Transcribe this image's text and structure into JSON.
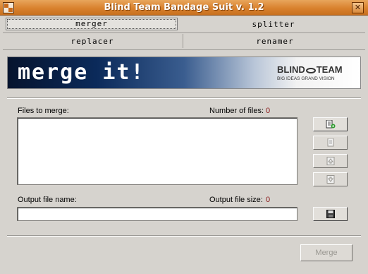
{
  "window": {
    "title": "Blind Team Bandage Suit v. 1.2"
  },
  "tabs": {
    "merger": "merger",
    "splitter": "splitter",
    "replacer": "replacer",
    "renamer": "renamer"
  },
  "banner": {
    "heading": "merge it!",
    "brand_left": "BLIND",
    "brand_right": "TEAM",
    "tagline": "BIG IDEAS GRAND VISION"
  },
  "files": {
    "label": "Files to merge:",
    "count_label": "Number of files:",
    "count": "0"
  },
  "output": {
    "label": "Output file name:",
    "value": "",
    "size_label": "Output file size:",
    "size": "0"
  },
  "buttons": {
    "merge": "Merge"
  },
  "icons": {
    "add": "add-file-icon",
    "remove": "remove-file-icon",
    "up": "move-up-icon",
    "down": "move-down-icon",
    "save": "save-icon"
  },
  "colors": {
    "titlebar": "#d9822e",
    "count": "#8b1a1a"
  }
}
